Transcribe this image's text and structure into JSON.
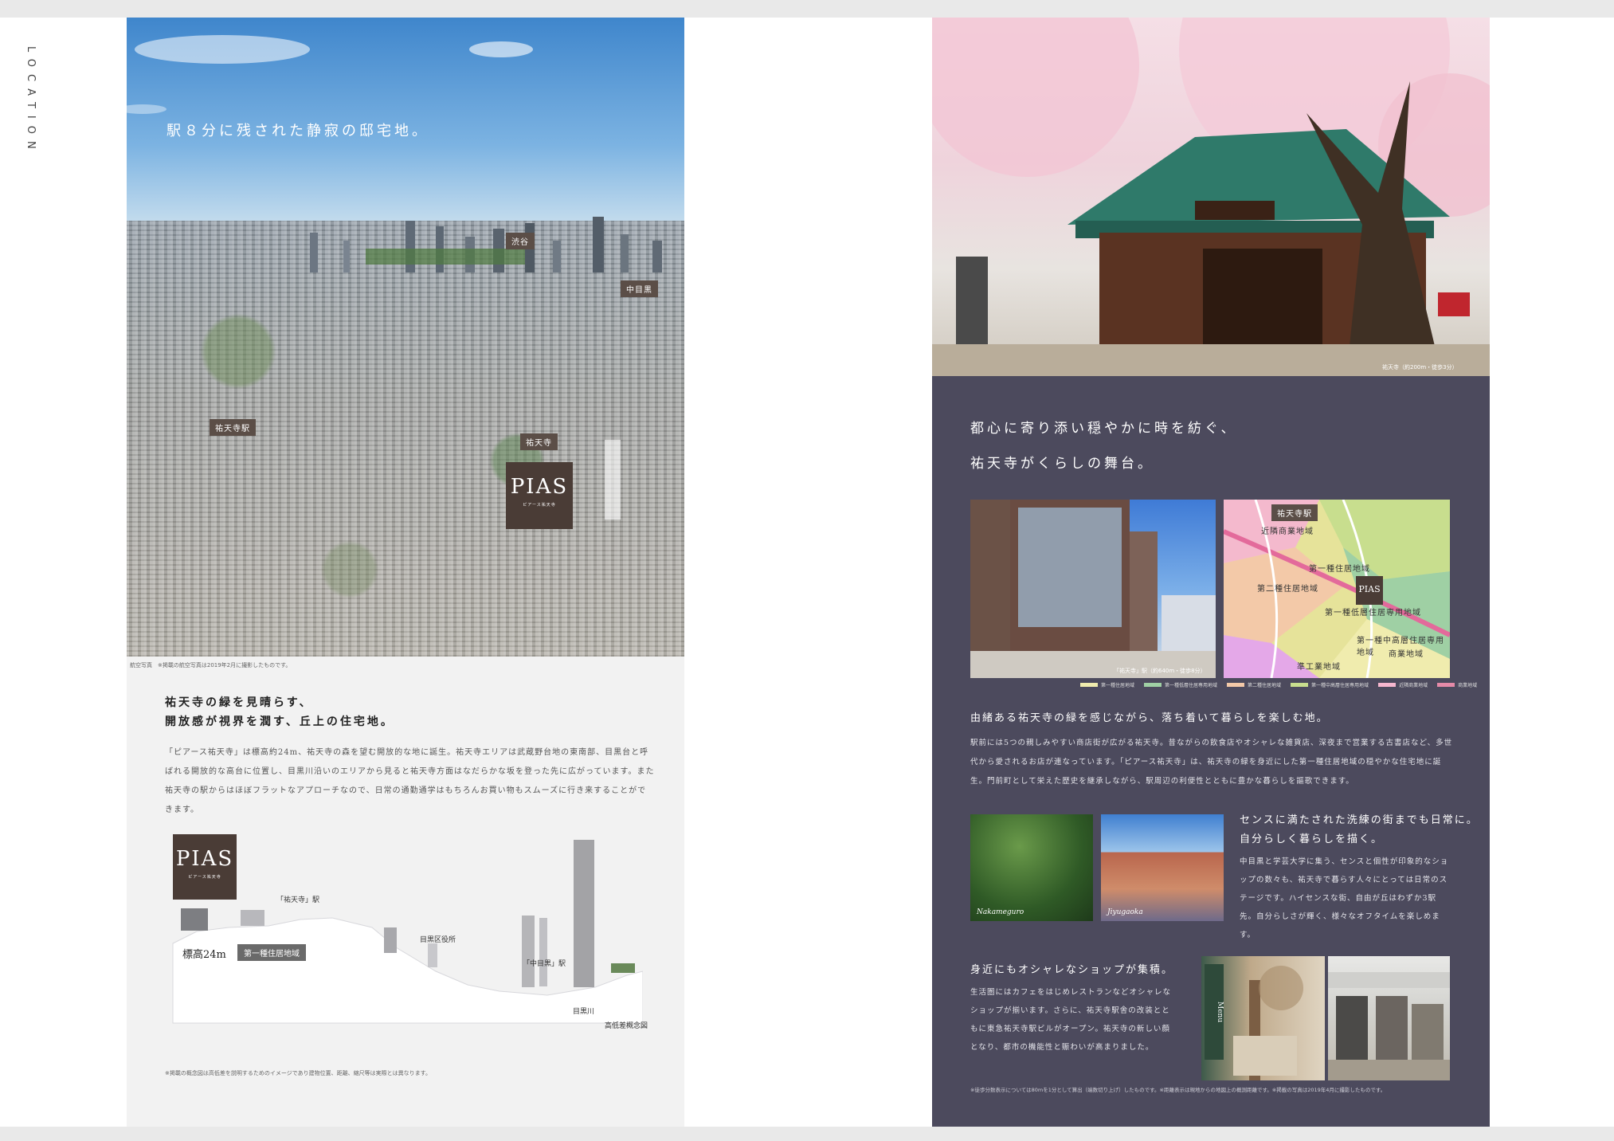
{
  "side_label": "LOCATION",
  "left": {
    "headline": "駅８分に残された静寂の邸宅地。",
    "map_labels": [
      "渋谷",
      "中目黒",
      "祐天寺駅",
      "祐天寺"
    ],
    "pias": {
      "word": "PIAS",
      "sub": "ピアース祐天寺"
    },
    "aerial_caption": "航空写真　※掲載の航空写真は2019年2月に撮影したものです。",
    "heading_line1": "祐天寺の緑を見晴らす、",
    "heading_line2": "開放感が視界を潤す、丘上の住宅地。",
    "body": "「ピアース祐天寺」は標高約24m、祐天寺の森を望む開放的な地に誕生。祐天寺エリアは武蔵野台地の東南部、目黒台と呼ばれる開放的な高台に位置し、目黒川沿いのエリアから見ると祐天寺方面はなだらかな坂を登った先に広がっています。また祐天寺の駅からはほぼフラットなアプローチなので、日常の通勤通学はもちろんお買い物もスムーズに行き来することができます。",
    "profile": {
      "station_label": "「祐天寺」駅",
      "ward_label": "目黒区役所",
      "naka_label": "「中目黒」駅",
      "river_label": "目黒川",
      "park_label": "高低差概念図",
      "elev_label": "標高24m",
      "zone_label": "第一種住居地域"
    },
    "footnote": "※掲載の概念図は高低差を説明するためのイメージであり建物位置、距離、縮尺等は実際とは異なります。"
  },
  "right": {
    "shrine_caption": "祐天寺（約200m・徒歩3分）",
    "heading_line1": "都心に寄り添い穏やかに時を紡ぐ、",
    "heading_line2": "祐天寺がくらしの舞台。",
    "bldg_caption": "「祐天寺」駅（約640m・徒歩8分）",
    "zone_map_labels": [
      "祐天寺駅",
      "近隣商業地域",
      "第一種住居地域",
      "第二種住居地域",
      "第一種低層住居専用地域",
      "第一種中高層住居専用地域",
      "商業地域",
      "準工業地域"
    ],
    "legend": [
      {
        "label": "第一種住居地域",
        "color": "#f0ecae"
      },
      {
        "label": "第一種低層住居専用地域",
        "color": "#9fd0a4"
      },
      {
        "label": "第二種住居地域",
        "color": "#f3c9a8"
      },
      {
        "label": "第一種中高層住居専用地域",
        "color": "#c8de8e"
      },
      {
        "label": "近隣商業地域",
        "color": "#f6b7cf"
      },
      {
        "label": "商業地域",
        "color": "#e58aa8"
      }
    ],
    "sub_heading": "由緒ある祐天寺の緑を感じながら、落ち着いて暮らしを楽しむ地。",
    "body": "駅前には5つの親しみやすい商店街が広がる祐天寺。昔ながらの飲食店やオシャレな雑貨店、深夜まで営業する古書店など、多世代から愛されるお店が連なっています。「ピアース祐天寺」は、祐天寺の緑を身近にした第一種住居地域の穏やかな住宅地に誕生。門前町として栄えた歴史を継承しながら、駅周辺の利便性とともに豊かな暮らしを謳歌できます。",
    "photo1_caption": "Nakameguro",
    "photo2_caption": "Jiyugaoka",
    "sense_line1": "センスに満たされた洗練の街までも日常に。",
    "sense_line2": "自分らしく暮らしを描く。",
    "sense_body": "中目黒と学芸大学に集う、センスと個性が印象的なショップの数々も、祐天寺で暮らす人々にとっては日常のステージです。ハイセンスな街、自由が丘はわずか3駅先。自分らしさが輝く、様々なオフタイムを楽しめます。",
    "shop_heading": "身近にもオシャレなショップが集積。",
    "shop_body": "生活圏にはカフェをはじめレストランなどオシャレなショップが揃います。さらに、祐天寺駅舎の改装とともに東急祐天寺駅ビルがオープン。祐天寺の新しい顔となり、都市の機能性と賑わいが高まりました。",
    "cafe_caption": "Menu",
    "note": "※徒歩分数表示については80mを1分として算出（端数切り上げ）したものです。※距離表示は現地からの地図上の概測距離です。※掲載の写真は2019年4月に撮影したものです。"
  }
}
